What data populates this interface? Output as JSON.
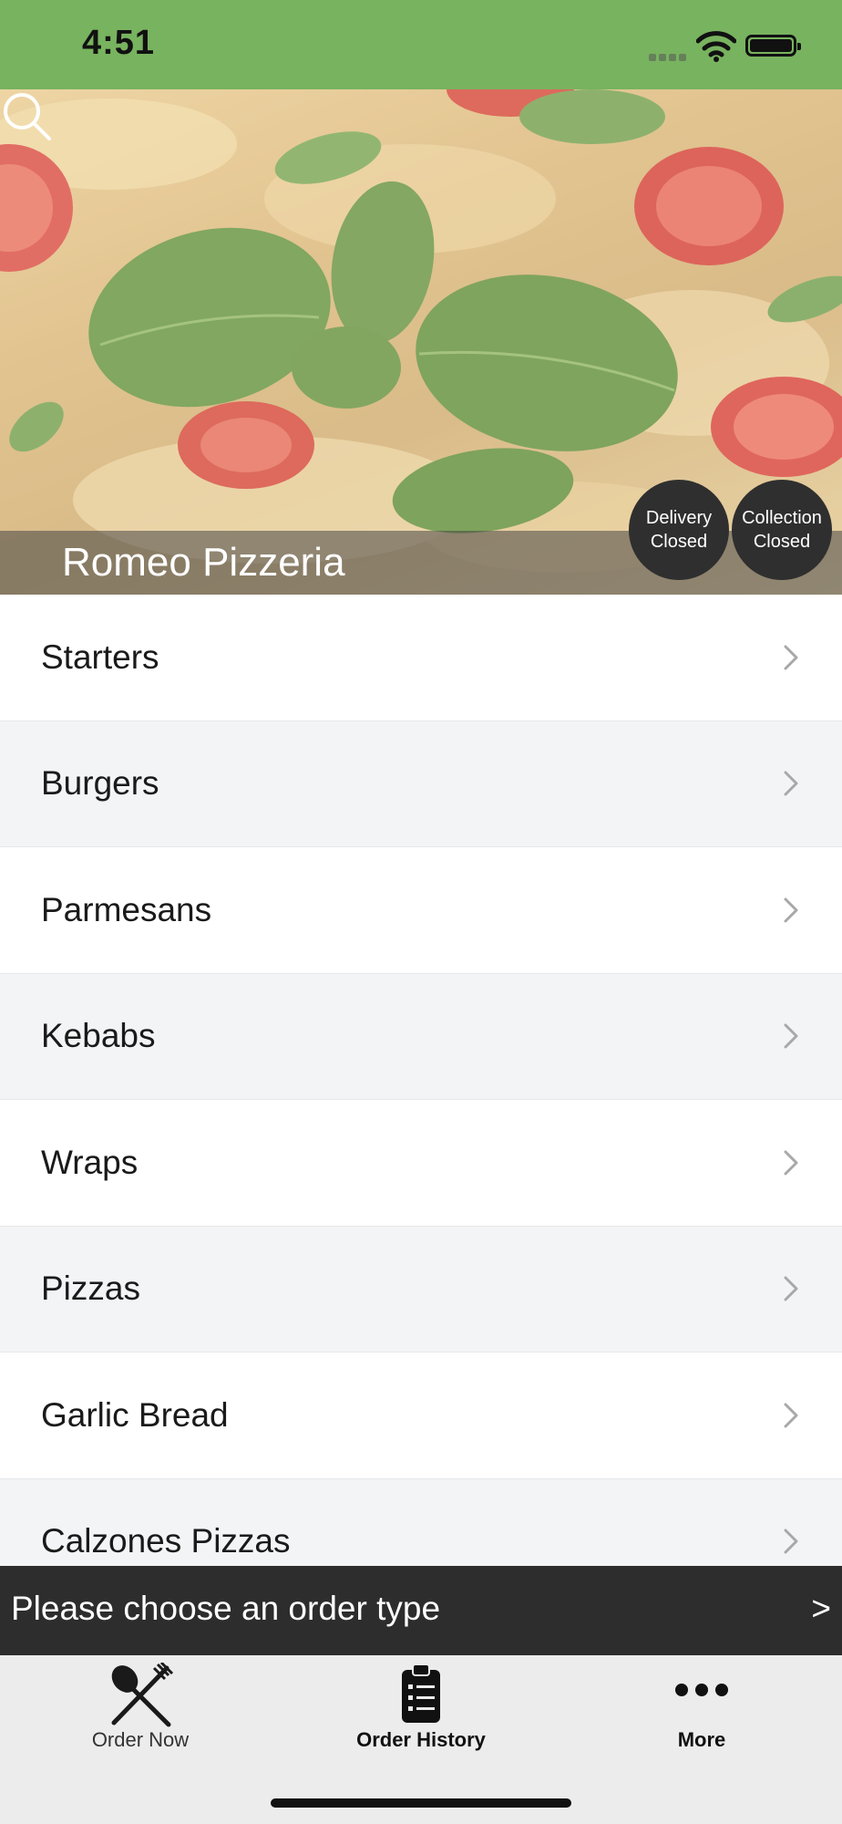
{
  "status_bar": {
    "time": "4:51"
  },
  "hero": {
    "restaurant_name": "Romeo Pizzeria",
    "delivery_badge": {
      "line1": "Delivery",
      "line2": "Closed"
    },
    "collection_badge": {
      "line1": "Collection",
      "line2": "Closed"
    },
    "search_icon": "search-icon"
  },
  "categories": [
    {
      "label": "Starters"
    },
    {
      "label": "Burgers"
    },
    {
      "label": "Parmesans"
    },
    {
      "label": "Kebabs"
    },
    {
      "label": "Wraps"
    },
    {
      "label": "Pizzas"
    },
    {
      "label": "Garlic Bread"
    },
    {
      "label": "Calzones Pizzas"
    }
  ],
  "order_banner": {
    "text": "Please choose an order type",
    "arrow": ">"
  },
  "tab_bar": {
    "tabs": [
      {
        "label": "Order Now",
        "icon": "spoon-fork-icon"
      },
      {
        "label": "Order History",
        "icon": "clipboard-list-icon"
      },
      {
        "label": "More",
        "icon": "more-dots-icon"
      }
    ]
  },
  "colors": {
    "status_bar": "#78b35f",
    "badge": "#2f2f2f",
    "banner": "#2d2d2d",
    "row_alt": "#f3f4f6",
    "tab_bar": "#ececec"
  }
}
